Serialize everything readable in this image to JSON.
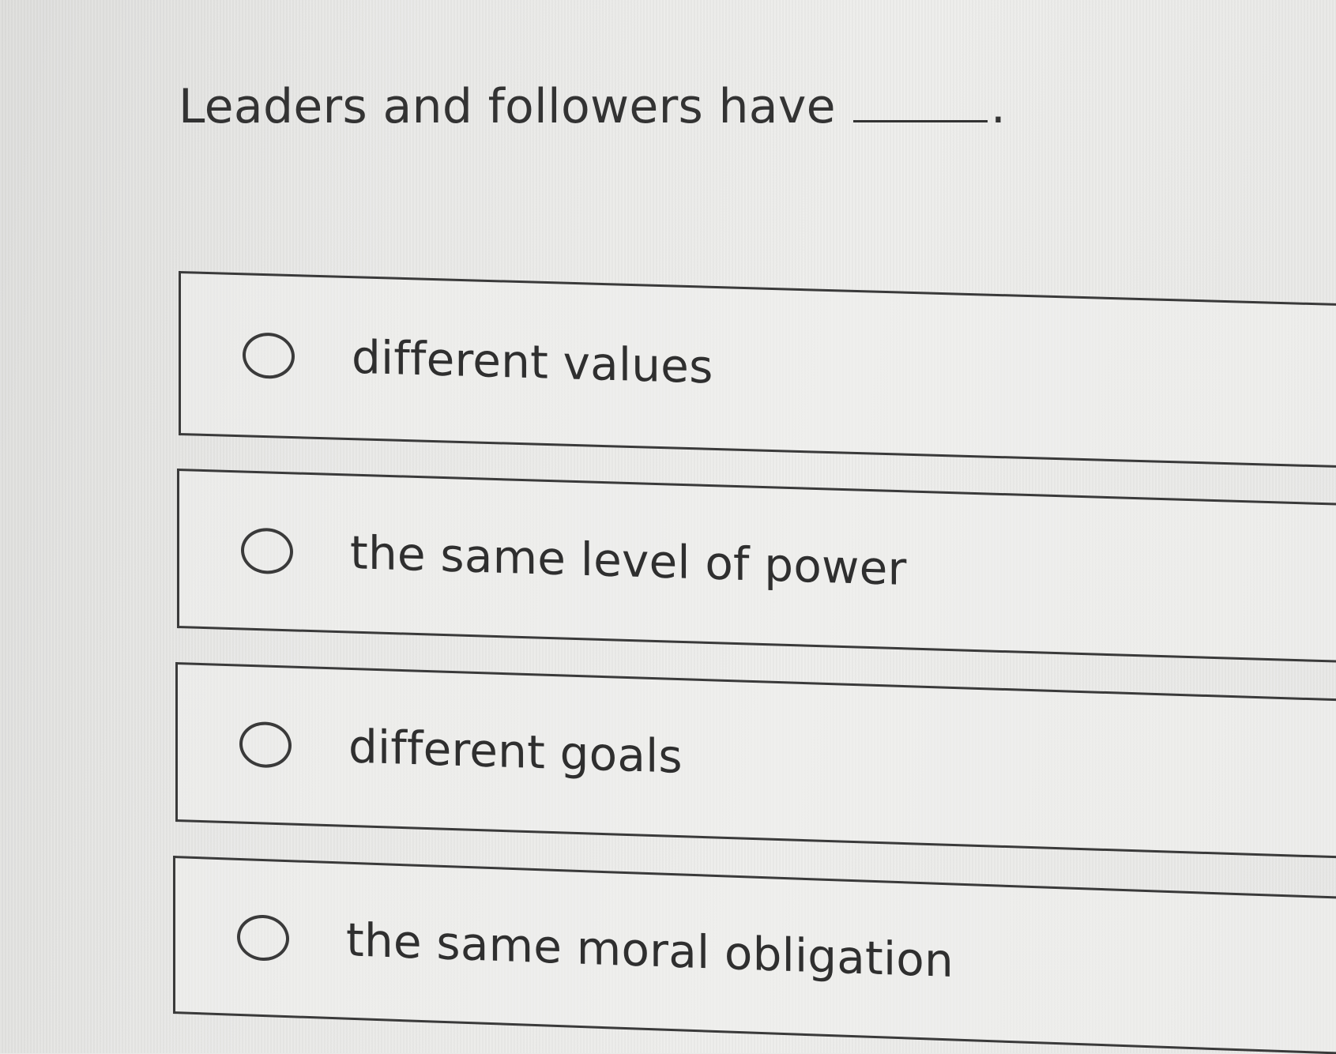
{
  "question": {
    "text": "Leaders and followers have",
    "period": "."
  },
  "options": [
    {
      "label": "different values",
      "selected": false
    },
    {
      "label": "the same level of power",
      "selected": false
    },
    {
      "label": "different goals",
      "selected": false
    },
    {
      "label": "the same moral obligation",
      "selected": false
    }
  ]
}
